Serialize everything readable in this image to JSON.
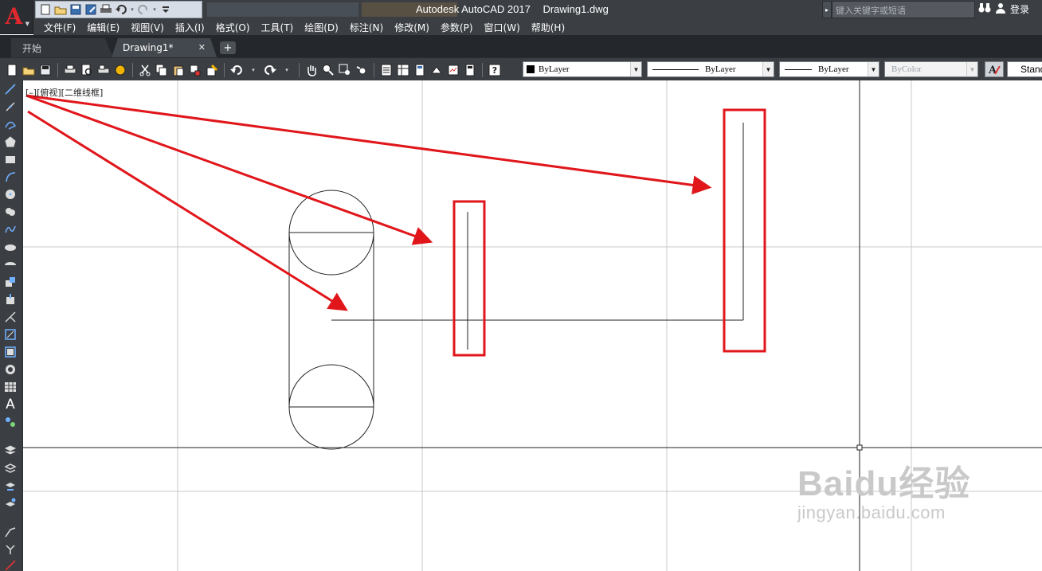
{
  "app": {
    "logo_letter": "A",
    "title": "Autodesk AutoCAD 2017",
    "document": "Drawing1.dwg"
  },
  "search": {
    "placeholder": "键入关键字或短语"
  },
  "account": {
    "login_label": "登录"
  },
  "menu": [
    "文件(F)",
    "编辑(E)",
    "视图(V)",
    "插入(I)",
    "格式(O)",
    "工具(T)",
    "绘图(D)",
    "标注(N)",
    "修改(M)",
    "参数(P)",
    "窗口(W)",
    "帮助(H)"
  ],
  "tabs": [
    {
      "label": "开始",
      "active": false
    },
    {
      "label": "Drawing1*",
      "active": true
    }
  ],
  "properties": {
    "color": "ByLayer",
    "linetype": "ByLayer",
    "lineweight": "ByLayer",
    "plotstyle": "ByColor",
    "text_style": "Stand"
  },
  "viewport": {
    "label": "[–][俯视][二维线框]"
  },
  "annotation": {
    "arrow_color": "#e0161b",
    "highlight_color": "#e0161b"
  },
  "watermark": {
    "brand": "Baidu经验",
    "url": "jingyan.baidu.com"
  }
}
